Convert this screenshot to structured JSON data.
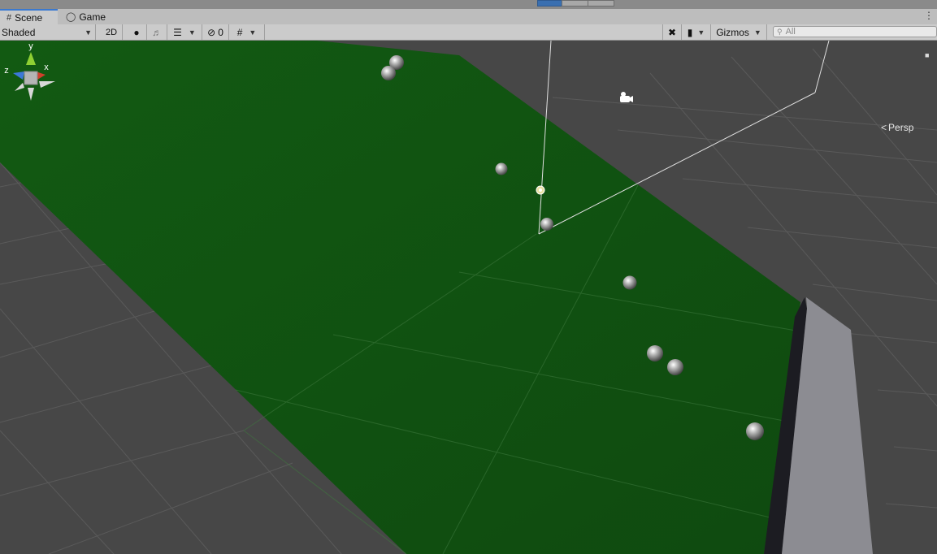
{
  "tabs": [
    {
      "label": "Scene",
      "icon": "grid-icon",
      "active": true
    },
    {
      "label": "Game",
      "icon": "gamepad-icon",
      "active": false
    }
  ],
  "toolbar": {
    "draw_mode": "Shaded",
    "two_d_label": "2D",
    "hidden_count": "0",
    "gizmos_label": "Gizmos",
    "search_placeholder": "All"
  },
  "viewport": {
    "projection_label": "Persp",
    "axis_labels": {
      "y": "y",
      "x": "x",
      "z": "z"
    },
    "plane_color": "#145a14",
    "wall_color": "#8c8c92",
    "background_color": "#474747"
  },
  "colors": {
    "accent": "#3a79d0",
    "toolbar_bg": "#cbcbcb",
    "axis_x": "#d0402c",
    "axis_y": "#8fd033",
    "axis_z": "#3c78d8"
  }
}
